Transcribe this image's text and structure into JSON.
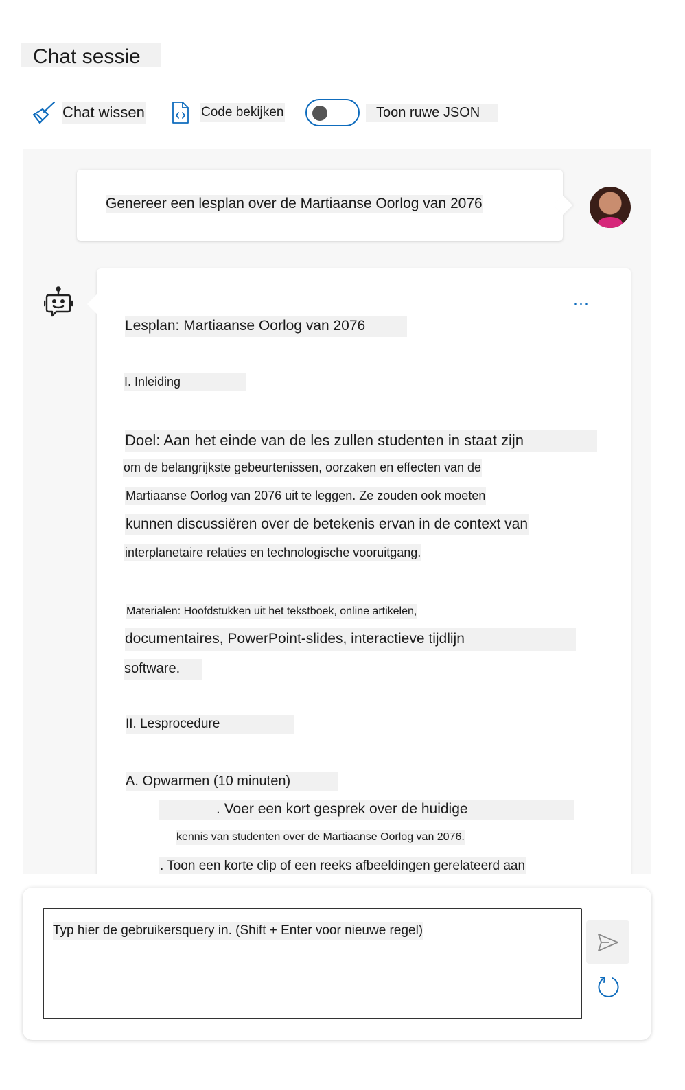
{
  "page": {
    "title": "Chat sessie"
  },
  "toolbar": {
    "clear_label": "Chat wissen",
    "view_code_label": "Code bekijken",
    "raw_json_label": "Toon ruwe JSON",
    "raw_json_enabled": false
  },
  "conversation": {
    "user_message": "Genereer een lesplan over de Martiaanse Oorlog van 2076",
    "assistant_lines": [
      "Lesplan: Martiaanse Oorlog van 2076",
      "I. Inleiding",
      "Doel: Aan het einde van de les zullen studenten in staat zijn",
      "om de belangrijkste gebeurtenissen, oorzaken en effecten van de",
      "Martiaanse Oorlog van 2076 uit te leggen. Ze zouden ook moeten",
      "kunnen discussiëren over de betekenis ervan in de context van",
      "interplanetaire relaties en technologische vooruitgang.",
      "Materialen: Hoofdstukken uit het tekstboek, online artikelen,",
      "documentaires, PowerPoint-slides, interactieve tijdlijn",
      "software.",
      "II. Lesprocedure",
      "A. Opwarmen (10 minuten)",
      ". Voer een kort gesprek over de huidige",
      "kennis van studenten over de Martiaanse Oorlog van 2076.",
      ". Toon een korte clip of een reeks afbeeldingen gerelateerd aan"
    ],
    "more_options": "..."
  },
  "input": {
    "placeholder": "Typ hier de gebruikersquery in. (Shift + Enter voor nieuwe regel)"
  },
  "colors": {
    "accent": "#0f6cbd",
    "chat_background": "#f7f7f7",
    "text_highlight": "#f1f1f1"
  },
  "icons": {
    "clear": "broom-icon",
    "code": "code-file-icon",
    "toggle": "toggle-switch",
    "bot": "bot-icon",
    "more": "more-horizontal-icon",
    "send": "send-icon",
    "reset": "refresh-icon"
  }
}
